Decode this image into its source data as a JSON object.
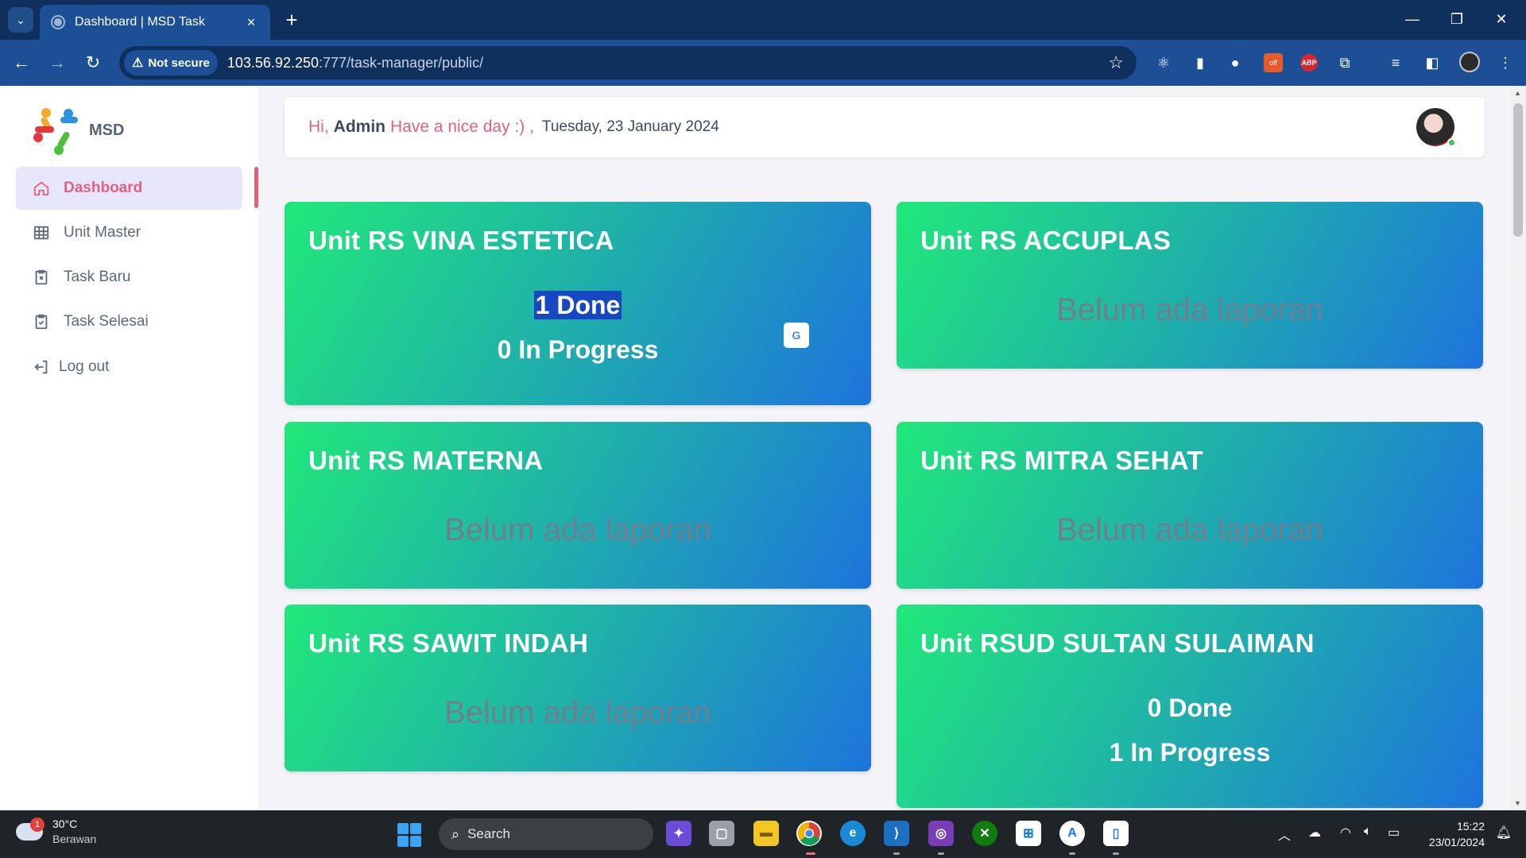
{
  "browser": {
    "tab_title": "Dashboard | MSD Task",
    "security_label": "Not secure",
    "url_host": "103.56.92.250",
    "url_path": ":777/task-manager/public/",
    "ext_abp_label": "ABP",
    "ext_off_label": "off"
  },
  "sidebar": {
    "brand": "MSD",
    "items": [
      {
        "label": "Dashboard",
        "icon": "home-icon",
        "active": true
      },
      {
        "label": "Unit Master",
        "icon": "table-icon"
      },
      {
        "label": "Task Baru",
        "icon": "clipboard-x-icon"
      },
      {
        "label": "Task Selesai",
        "icon": "clipboard-check-icon"
      },
      {
        "label": "Log out",
        "icon": "logout-icon"
      }
    ]
  },
  "header": {
    "hi": "Hi,",
    "name": "Admin",
    "message": "Have a nice day :) ,",
    "date": "Tuesday, 23 January 2024"
  },
  "units": [
    {
      "title": "Unit RS VINA ESTETICA",
      "done": "1 Done",
      "in_progress": "0 In Progress"
    },
    {
      "title": "Unit RS ACCUPLAS",
      "empty": "Belum ada laporan"
    },
    {
      "title": "Unit RS MATERNA",
      "empty": "Belum ada laporan"
    },
    {
      "title": "Unit RS MITRA SEHAT",
      "empty": "Belum ada laporan"
    },
    {
      "title": "Unit RS SAWIT INDAH",
      "empty": "Belum ada laporan"
    },
    {
      "title": "Unit RSUD SULTAN SULAIMAN",
      "done": "0 Done",
      "in_progress": "1 In Progress"
    }
  ],
  "taskbar": {
    "notif_count": "1",
    "temperature": "30°C",
    "weather": "Berawan",
    "search_label": "Search",
    "time": "15:22",
    "date": "23/01/2024"
  },
  "colors": {
    "accent": "#e0617f",
    "card_gradient_start": "#20e87a",
    "card_gradient_end": "#1d74dc",
    "chrome_blue": "#1c4f95"
  }
}
